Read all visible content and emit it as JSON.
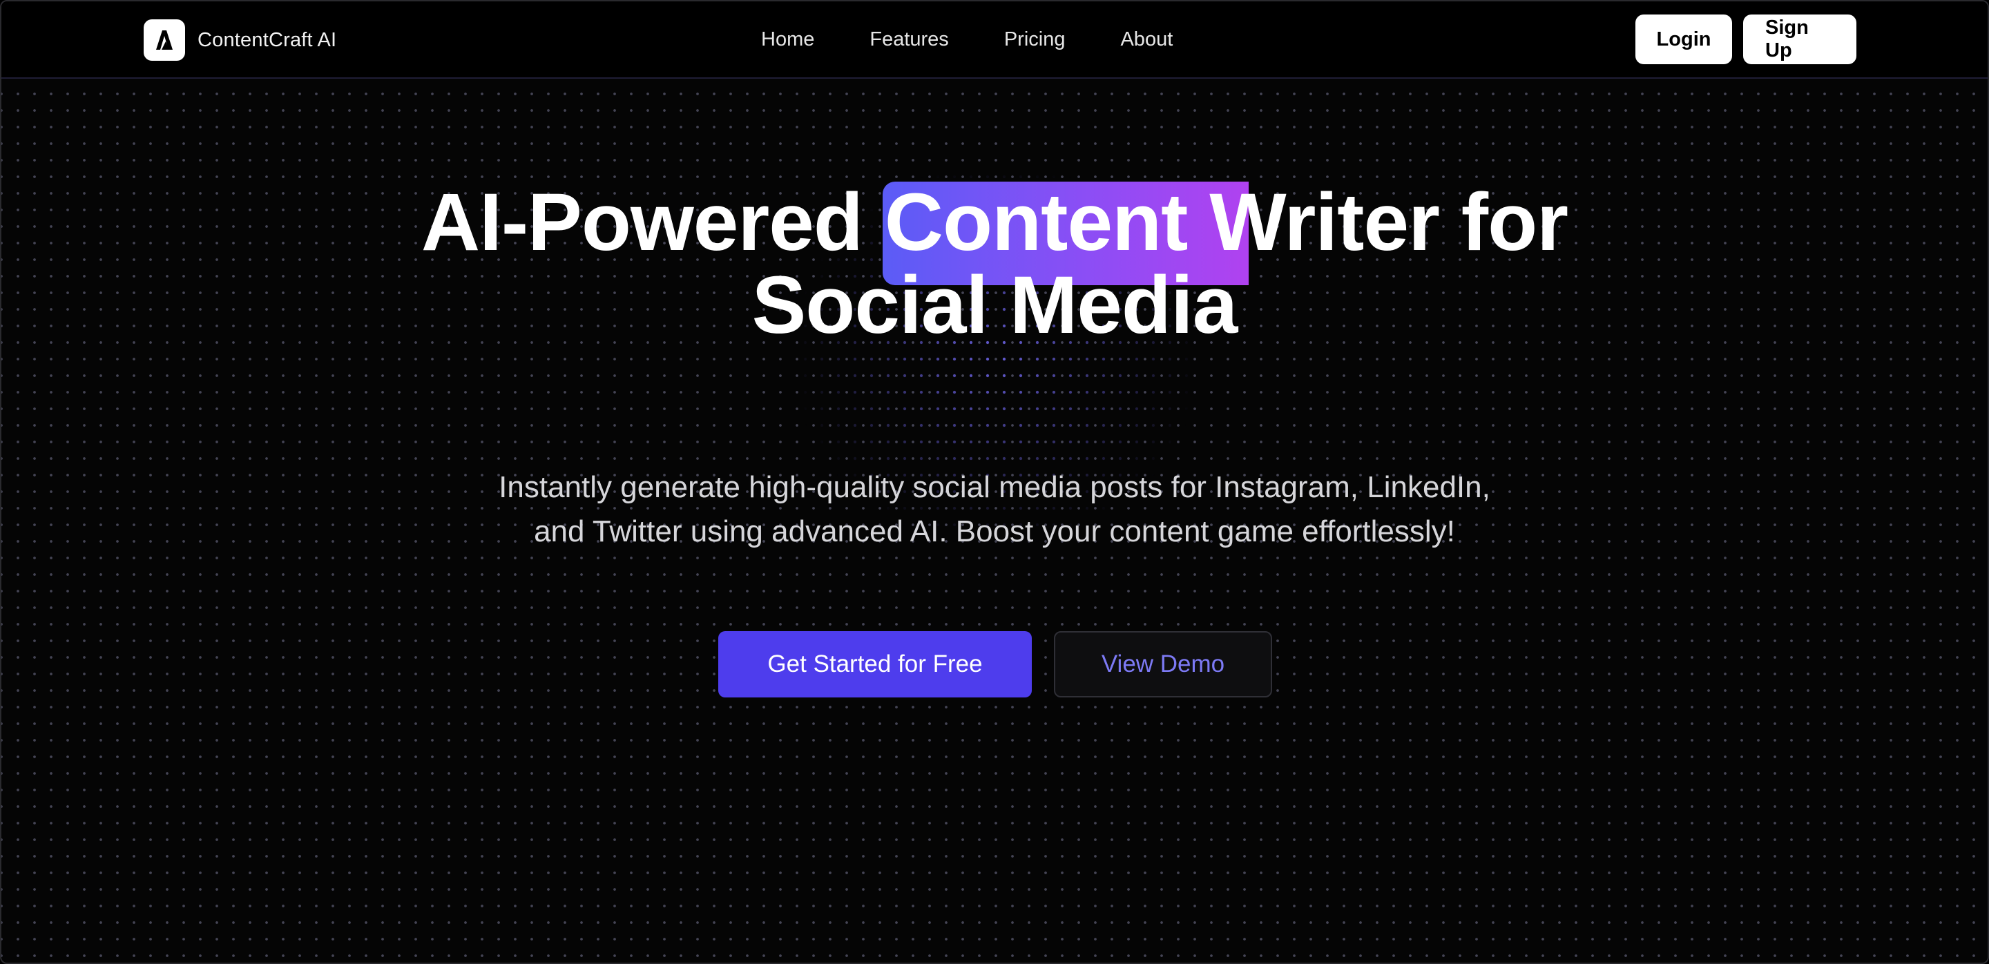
{
  "header": {
    "brand_name": "ContentCraft AI",
    "logo_icon": "logo-a-icon",
    "nav": [
      {
        "label": "Home"
      },
      {
        "label": "Features"
      },
      {
        "label": "Pricing"
      },
      {
        "label": "About"
      }
    ],
    "login_label": "Login",
    "signup_label": "Sign Up"
  },
  "hero": {
    "title_line1": "AI-Powered Content Writer for",
    "title_line2": "Social Media",
    "highlight_colors": [
      "#5b5cf6",
      "#b042f0"
    ],
    "subtitle_line1": "Instantly generate high-quality social media posts for Instagram, LinkedIn,",
    "subtitle_line2": "and Twitter using advanced AI. Boost your content game effortlessly!",
    "cta_primary": "Get Started for Free",
    "cta_secondary": "View Demo"
  },
  "colors": {
    "accent": "#4e3ded",
    "secondary_text": "#7d7af5",
    "background": "#050505"
  }
}
